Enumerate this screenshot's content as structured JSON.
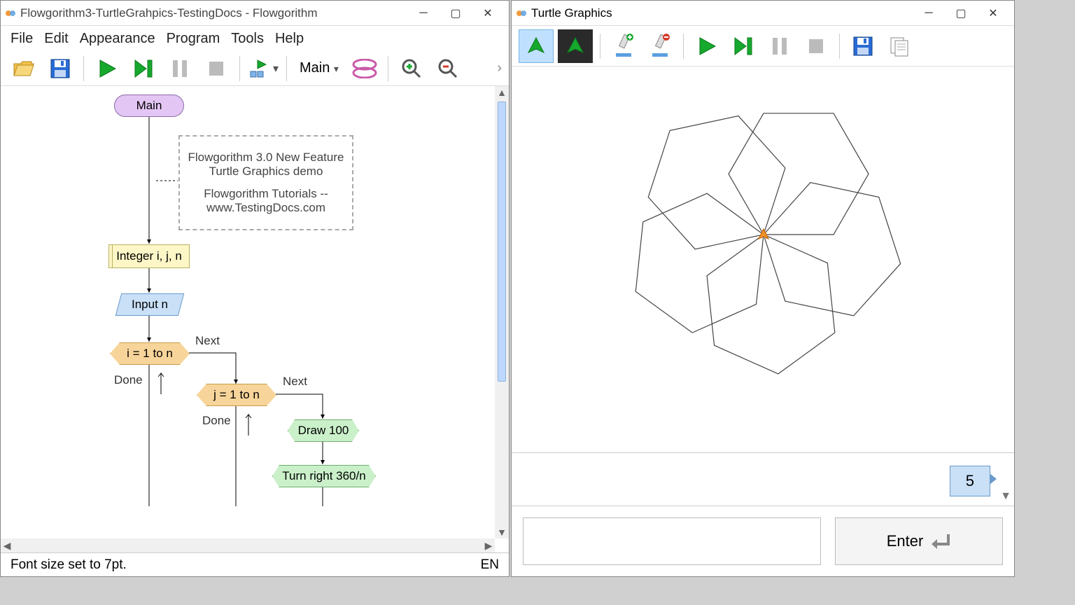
{
  "flowgorithm": {
    "title": "Flowgorithm3-TurtleGrahpics-TestingDocs - Flowgorithm",
    "menu": [
      "File",
      "Edit",
      "Appearance",
      "Program",
      "Tools",
      "Help"
    ],
    "function_label": "Main",
    "status_text": "Font size set to 7pt.",
    "language": "EN",
    "comment1": "Flowgorithm 3.0 New Feature Turtle Graphics demo",
    "comment2": "Flowgorithm Tutorials --www.TestingDocs.com",
    "shapes": {
      "main": "Main",
      "declare": "Integer i, j, n",
      "input": "Input n",
      "loop_i": "i = 1 to n",
      "loop_j": "j = 1 to n",
      "draw": "Draw 100",
      "turn": "Turn right 360/n"
    },
    "labels": {
      "next": "Next",
      "done": "Done"
    }
  },
  "turtle": {
    "title": "Turtle Graphics",
    "output_value": "5",
    "enter_label": "Enter"
  }
}
